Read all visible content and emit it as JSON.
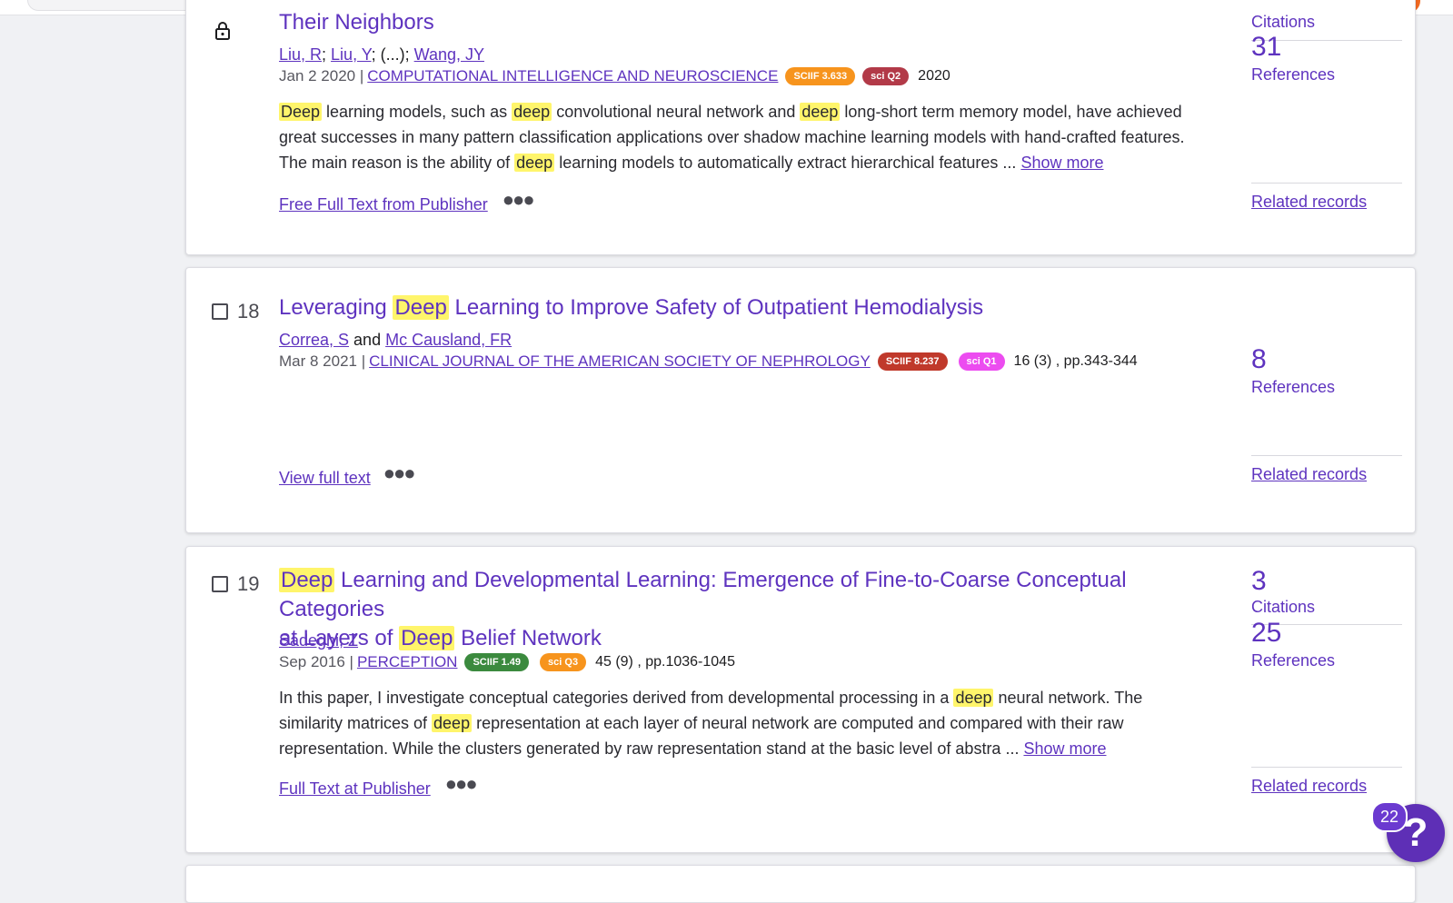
{
  "colors": {
    "accent": "#5e33bf",
    "highlight": "#fff56b",
    "sciif_orange": "#f7941d",
    "sciif_red": "#c0392b",
    "sciif_green": "#3b8a3e",
    "sci_q1": "#ec4cf0",
    "sci_q2": "#b23a48",
    "sci_q3": "#f7941d"
  },
  "records": [
    {
      "title_parts": [
        "Their Neighbors"
      ],
      "authors": [
        "Liu, R",
        "Liu, Y",
        "(...)",
        "Wang, JY"
      ],
      "date": "Jan 2 2020",
      "journal": "COMPUTATIONAL INTELLIGENCE AND NEUROSCIENCE",
      "sciif": "SCIIF 3.633",
      "sci": "sci Q2",
      "extra": "2020",
      "abstract": {
        "l1": [
          "Deep",
          " learning models, such as ",
          "deep",
          " convolutional neural network and ",
          "deep",
          " long-short term memory model, have achieved"
        ],
        "l2": "great successes in many pattern classification applications over shadow machine learning models with hand-crafted features.",
        "l3": [
          "The main reason is the ability of ",
          "deep",
          " learning models to automatically extract hierarchical features  ... "
        ]
      },
      "show_more": "Show more",
      "fulltext": "Free Full Text from Publisher",
      "citations_label": "Citations",
      "references_count": "31",
      "references_label": "References",
      "related": "Related records"
    },
    {
      "number": "18",
      "title_parts": [
        "Leveraging ",
        "Deep",
        " Learning to Improve Safety of Outpatient Hemodialysis"
      ],
      "authors": [
        "Correa, S",
        "and",
        "Mc Causland, FR"
      ],
      "date": "Mar 8 2021",
      "journal": "CLINICAL JOURNAL OF THE AMERICAN SOCIETY OF NEPHROLOGY",
      "sciif": "SCIIF 8.237",
      "sci": "sci Q1",
      "extra": "16 (3) , pp.343-344",
      "fulltext": "View full text",
      "references_count": "8",
      "references_label": "References",
      "related": "Related records"
    },
    {
      "number": "19",
      "title_line1": [
        "Deep",
        " Learning and Developmental Learning: Emergence of Fine-to-Coarse Conceptual Categories"
      ],
      "title_line2": [
        "at Layers of ",
        "Deep",
        " Belief Network"
      ],
      "authors": [
        "Sadeghi, Z"
      ],
      "date": "Sep 2016",
      "journal": "PERCEPTION",
      "sciif": "SCIIF 1.49",
      "sci": "sci Q3",
      "extra": "45 (9) , pp.1036-1045",
      "abstract": {
        "l1": [
          "In this paper, I investigate conceptual categories derived from developmental processing in a ",
          "deep",
          " neural network. The"
        ],
        "l2": [
          "similarity matrices of ",
          "deep",
          " representation at each layer of neural network are computed and compared with their raw"
        ],
        "l3": "representation. While the clusters generated by raw representation stand at the basic level of abstra ... "
      },
      "show_more": "Show more",
      "fulltext": "Full Text at Publisher",
      "citations_count": "3",
      "citations_label": "Citations",
      "references_count": "25",
      "references_label": "References",
      "related": "Related records"
    }
  ],
  "help": {
    "badge": "22",
    "label": "?"
  },
  "icons": {
    "lock": "lock-icon",
    "more": "more-options-icon",
    "help": "help-icon"
  }
}
